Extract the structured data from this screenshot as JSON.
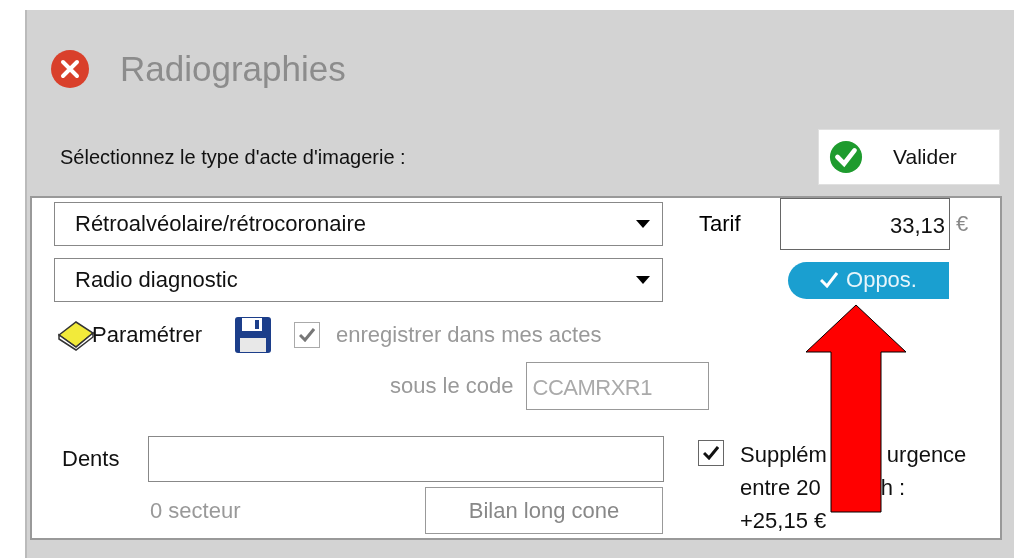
{
  "window": {
    "title": "Radiographies"
  },
  "prompt": "Sélectionnez le type d'acte d'imagerie :",
  "validate_button": "Valider",
  "act_type": {
    "value": "Rétroalvéolaire/rétrocoronaire"
  },
  "act_category": {
    "value": "Radio diagnostic"
  },
  "tarif": {
    "label": "Tarif",
    "value": "33,13",
    "unit": "€"
  },
  "oppos_badge": {
    "label": "Oppos.",
    "checked": true
  },
  "configure_link": "Paramétrer",
  "save_to_my_acts": {
    "label": "enregistrer dans mes actes",
    "checked": true,
    "disabled": true
  },
  "code": {
    "label": "sous le code",
    "value": "CCAMRXR1",
    "disabled": true
  },
  "teeth": {
    "label": "Dents",
    "sector_count": "0 secteur"
  },
  "long_cone_button": "Bilan long cone",
  "urgency_supplement": {
    "checked": true,
    "lines": [
      [
        "Supplém",
        "urgence"
      ],
      [
        "entre 20",
        "h :"
      ],
      [
        "+25,15 €"
      ]
    ]
  }
}
